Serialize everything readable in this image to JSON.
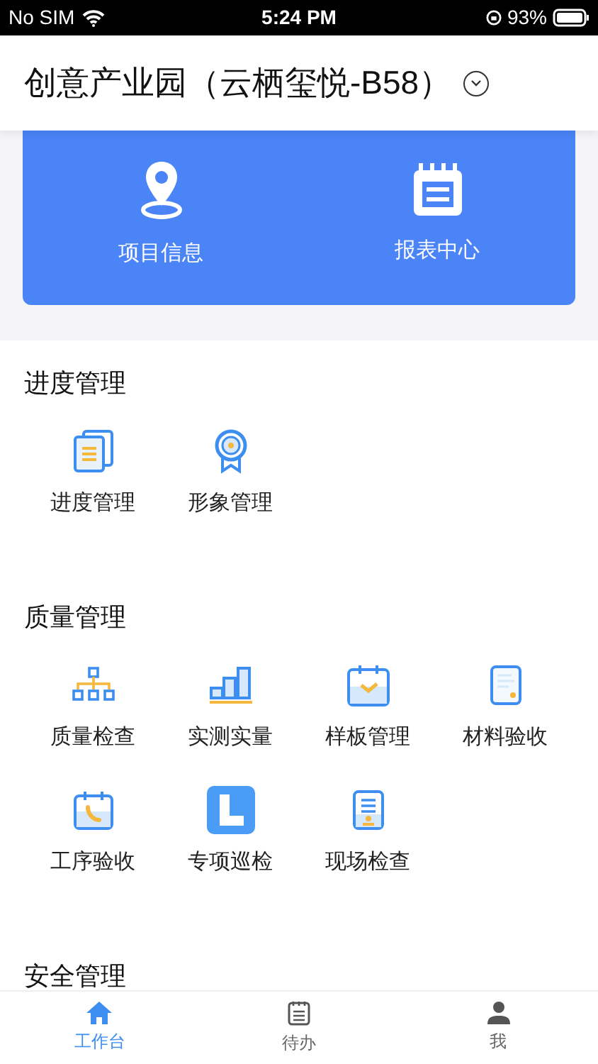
{
  "status_bar": {
    "carrier": "No SIM",
    "time": "5:24 PM",
    "battery": "93%"
  },
  "header": {
    "title": "创意产业园（云栖玺悦-B58）"
  },
  "quick_actions": [
    {
      "label": "项目信息"
    },
    {
      "label": "报表中心"
    }
  ],
  "sections": [
    {
      "title": "进度管理",
      "items": [
        {
          "label": "进度管理"
        },
        {
          "label": "形象管理"
        }
      ]
    },
    {
      "title": "质量管理",
      "items": [
        {
          "label": "质量检查"
        },
        {
          "label": "实测实量"
        },
        {
          "label": "样板管理"
        },
        {
          "label": "材料验收"
        },
        {
          "label": "工序验收"
        },
        {
          "label": "专项巡检"
        },
        {
          "label": "现场检查"
        }
      ]
    },
    {
      "title": "安全管理"
    }
  ],
  "tab_bar": [
    {
      "label": "工作台",
      "selected": true
    },
    {
      "label": "待办",
      "selected": false
    },
    {
      "label": "我",
      "selected": false
    }
  ]
}
